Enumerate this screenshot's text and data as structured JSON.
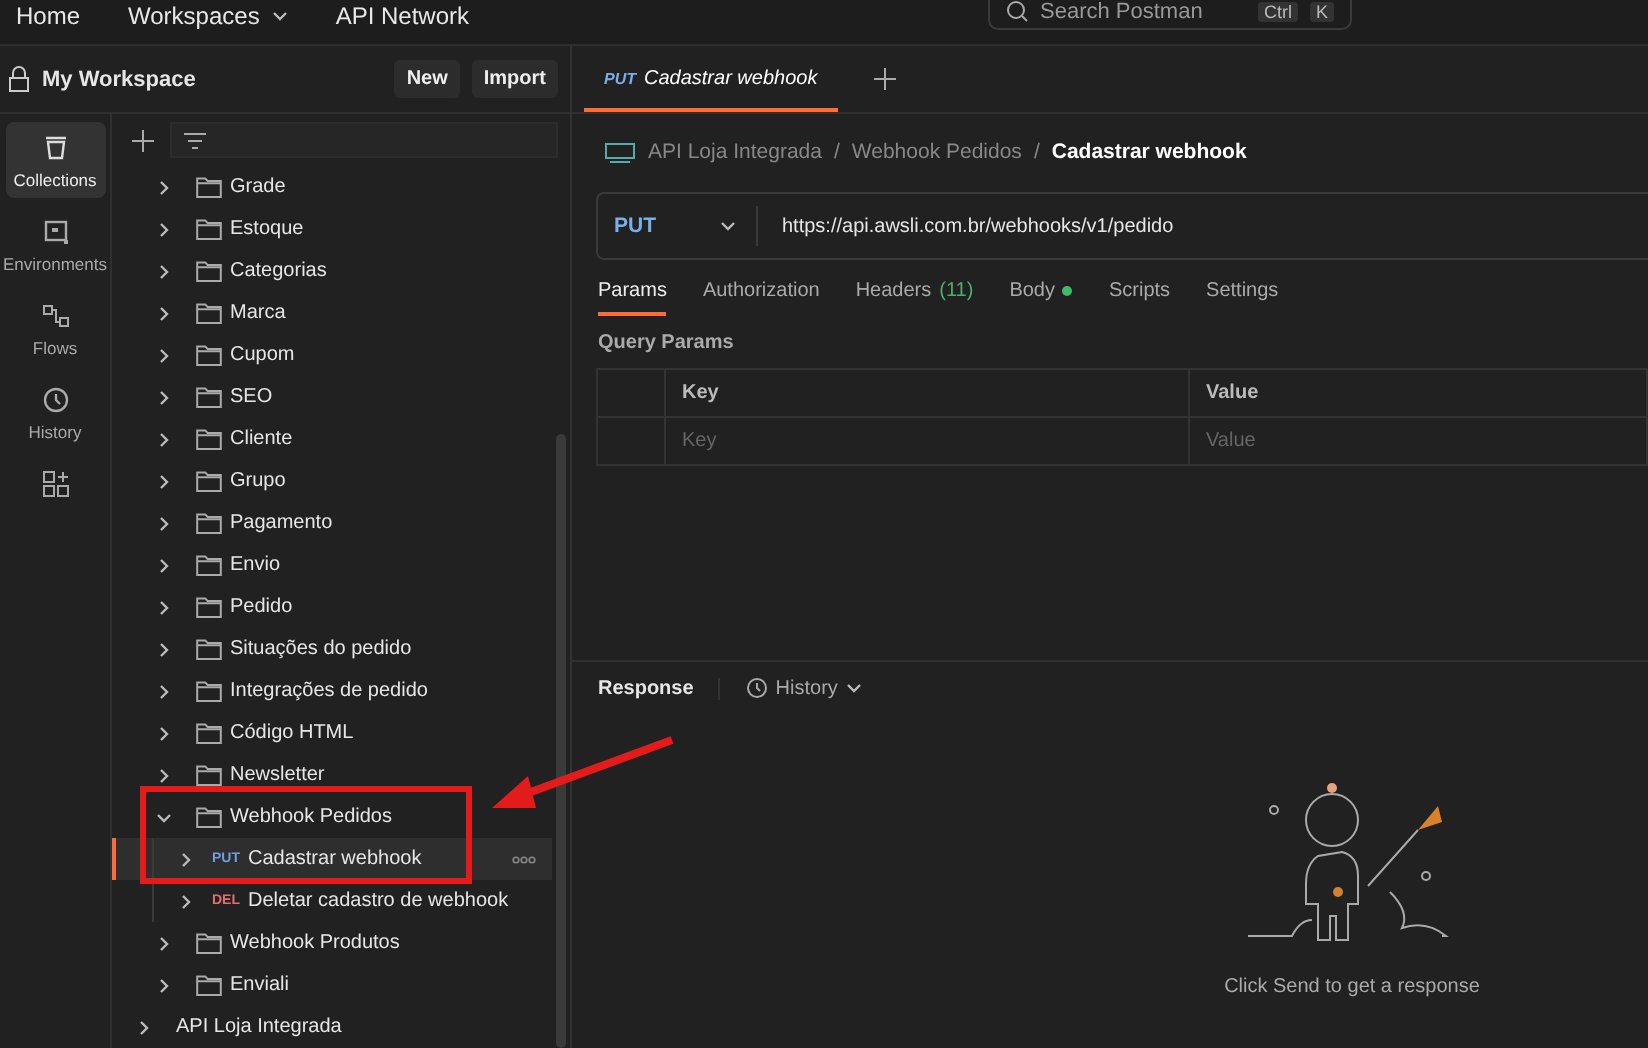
{
  "top_bar": {
    "nav": [
      {
        "label": "Home",
        "dropdown": false
      },
      {
        "label": "Workspaces",
        "dropdown": true
      },
      {
        "label": "API Network",
        "dropdown": false
      }
    ],
    "search": {
      "placeholder": "Search Postman",
      "keys": [
        "Ctrl",
        "K"
      ]
    }
  },
  "workspace": {
    "title": "My Workspace",
    "buttons": [
      "New",
      "Import"
    ]
  },
  "rail": [
    {
      "label": "Collections",
      "selected": true
    },
    {
      "label": "Environments",
      "selected": false
    },
    {
      "label": "Flows",
      "selected": false
    },
    {
      "label": "History",
      "selected": false
    }
  ],
  "tree": [
    {
      "kind": "folder",
      "name": "Grade",
      "expanded": false
    },
    {
      "kind": "folder",
      "name": "Estoque",
      "expanded": false
    },
    {
      "kind": "folder",
      "name": "Categorias",
      "expanded": false
    },
    {
      "kind": "folder",
      "name": "Marca",
      "expanded": false
    },
    {
      "kind": "folder",
      "name": "Cupom",
      "expanded": false
    },
    {
      "kind": "folder",
      "name": "SEO",
      "expanded": false
    },
    {
      "kind": "folder",
      "name": "Cliente",
      "expanded": false
    },
    {
      "kind": "folder",
      "name": "Grupo",
      "expanded": false
    },
    {
      "kind": "folder",
      "name": "Pagamento",
      "expanded": false
    },
    {
      "kind": "folder",
      "name": "Envio",
      "expanded": false
    },
    {
      "kind": "folder",
      "name": "Pedido",
      "expanded": false
    },
    {
      "kind": "folder",
      "name": "Situações do pedido",
      "expanded": false
    },
    {
      "kind": "folder",
      "name": "Integrações de pedido",
      "expanded": false
    },
    {
      "kind": "folder",
      "name": "Código HTML",
      "expanded": false
    },
    {
      "kind": "folder",
      "name": "Newsletter",
      "expanded": false
    },
    {
      "kind": "folder",
      "name": "Webhook Pedidos",
      "expanded": true,
      "children": [
        {
          "kind": "request",
          "method": "PUT",
          "color": "#6f9fe0",
          "name": "Cadastrar webhook",
          "selected": true
        },
        {
          "kind": "request",
          "method": "DEL",
          "color": "#e07070",
          "name": "Deletar cadastro de webhook",
          "selected": false
        }
      ]
    },
    {
      "kind": "folder",
      "name": "Webhook Produtos",
      "expanded": false
    },
    {
      "kind": "folder",
      "name": "Enviali",
      "expanded": false
    },
    {
      "kind": "collection",
      "name": "API Loja Integrada",
      "expanded": false
    }
  ],
  "tabs": [
    {
      "method": "PUT",
      "name": "Cadastrar webhook",
      "selected": true
    }
  ],
  "breadcrumb": [
    {
      "label": "API Loja Integrada"
    },
    {
      "separator": "/",
      "label": "Webhook Pedidos"
    },
    {
      "separator": "/",
      "label": "Cadastrar webhook"
    }
  ],
  "request": {
    "method": "PUT",
    "url": "https://api.awsli.com.br/webhooks/v1/pedido"
  },
  "request_tabs": [
    {
      "label": "Params",
      "selected": true
    },
    {
      "label": "Authorization",
      "selected": false
    },
    {
      "label": "Headers",
      "count": "(11)",
      "selected": false
    },
    {
      "label": "Body",
      "has_content": true,
      "selected": false
    },
    {
      "label": "Scripts",
      "selected": false
    },
    {
      "label": "Settings",
      "selected": false
    }
  ],
  "query_params": {
    "title": "Query Params",
    "columns": [
      "Key",
      "Value"
    ],
    "placeholders": [
      "Key",
      "Value"
    ]
  },
  "response": {
    "title": "Response",
    "history": "History",
    "empty_message": "Click Send to get a response"
  }
}
